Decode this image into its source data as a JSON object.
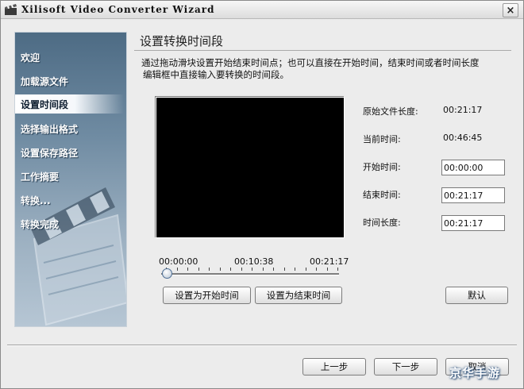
{
  "window": {
    "title": "Xilisoft Video Converter Wizard",
    "close_glyph": "×"
  },
  "sidebar": {
    "items": [
      {
        "label": "欢迎",
        "active": false
      },
      {
        "label": "加载源文件",
        "active": false
      },
      {
        "label": "设置时间段",
        "active": true
      },
      {
        "label": "选择输出格式",
        "active": false
      },
      {
        "label": "设置保存路径",
        "active": false
      },
      {
        "label": "工作摘要",
        "active": false
      },
      {
        "label": "转换...",
        "active": false
      },
      {
        "label": "转换完成",
        "active": false
      }
    ]
  },
  "main": {
    "heading": "设置转换时间段",
    "instruction_line1": "通过拖动滑块设置开始结束时间点；也可以直接在开始时间，结束时间或者时间长度",
    "instruction_line2": "编辑框中直接输入要转换的时间段。"
  },
  "timeline": {
    "start": "00:00:00",
    "middle": "00:10:38",
    "end": "00:21:17",
    "slider_position": 0.0
  },
  "buttons": {
    "set_start": "设置为开始时间",
    "set_end": "设置为结束时间",
    "default": "默认",
    "prev": "上一步",
    "next": "下一步",
    "cancel": "取消"
  },
  "info": {
    "original_length_label": "原始文件长度:",
    "original_length_value": "00:21:17",
    "current_time_label": "当前时间:",
    "current_time_value": "00:46:45",
    "start_time_label": "开始时间:",
    "start_time_value": "00:00:00",
    "end_time_label": "结束时间:",
    "end_time_value": "00:21:17",
    "duration_label": "时间长度:",
    "duration_value": "00:21:17"
  },
  "watermark": "京华手游"
}
